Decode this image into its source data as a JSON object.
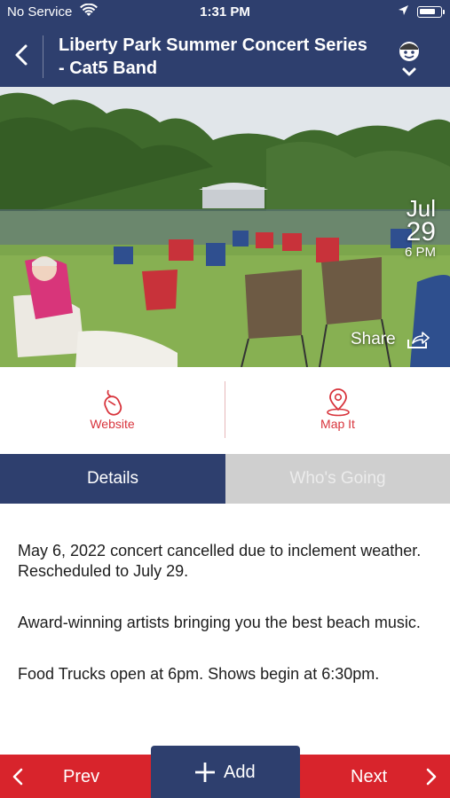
{
  "status_bar": {
    "carrier": "No Service",
    "time": "1:31 PM"
  },
  "header": {
    "title": "Liberty Park Summer Concert Series - Cat5 Band",
    "back_icon": "chevron-left-icon",
    "mascot_icon": "mascot-icon"
  },
  "hero": {
    "date_month": "Jul",
    "date_day": "29",
    "date_time": "6 PM",
    "share_label": "Share"
  },
  "actions": {
    "website_label": "Website",
    "mapit_label": "Map It"
  },
  "tabs": [
    {
      "label": "Details",
      "active": true
    },
    {
      "label": "Who's Going",
      "active": false
    }
  ],
  "details": {
    "paragraphs": [
      "May 6, 2022 concert cancelled due to inclement weather.  Rescheduled to July 29.",
      "Award-winning artists bringing you the best beach music.",
      "Food Trucks open at 6pm.  Shows begin at 6:30pm."
    ]
  },
  "bottom_bar": {
    "prev_label": "Prev",
    "add_label": "Add",
    "next_label": "Next"
  },
  "colors": {
    "navy": "#2e3f6e",
    "red": "#d8242c",
    "tab_inactive": "#cfcfcf"
  }
}
